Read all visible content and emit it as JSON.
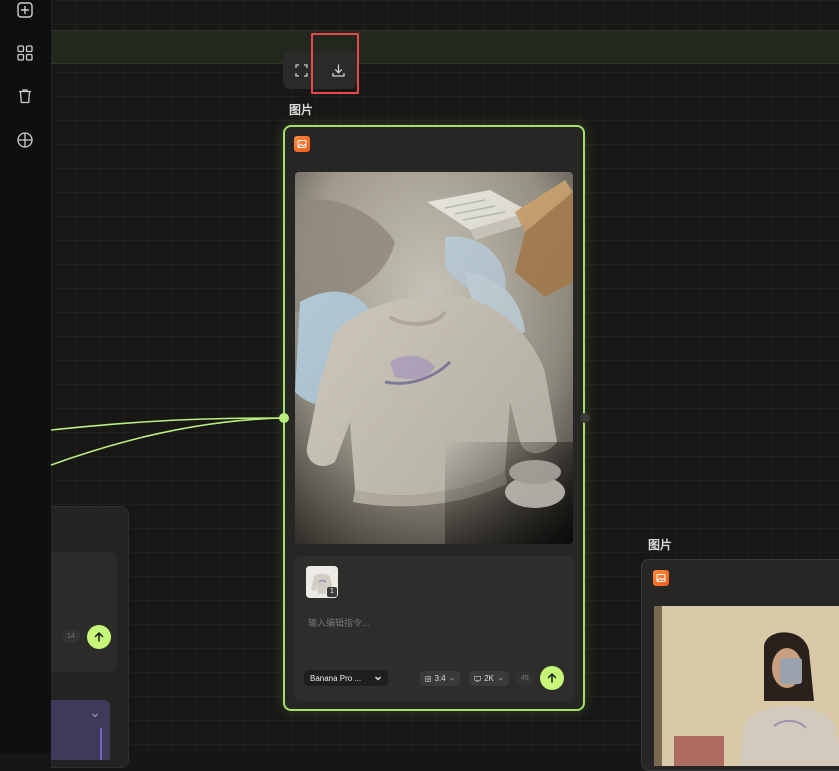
{
  "toolbar": {
    "items": [
      {
        "name": "add-node-button",
        "icon": "plus-square-icon"
      },
      {
        "name": "apps-button",
        "icon": "grid-icon"
      },
      {
        "name": "delete-button",
        "icon": "trash-icon"
      },
      {
        "name": "globe-button",
        "icon": "globe-icon"
      }
    ]
  },
  "action_bar": {
    "fullscreen_icon": "fullscreen-icon",
    "download_icon": "download-icon"
  },
  "main_node": {
    "title": "图片",
    "badge_icon": "image-icon",
    "reference_count": "1",
    "prompt_placeholder": "输入编辑指令...",
    "model_value": "Banana Pro ...",
    "aspect_ratio": "3:4",
    "resolution": "2K",
    "credits": "49"
  },
  "left_node": {
    "credits": "14"
  },
  "right_node": {
    "title": "图片",
    "badge_icon": "image-icon"
  },
  "colors": {
    "accent": "#a4e067",
    "send_button": "#c6f778",
    "highlight": "#e8474c",
    "badge": "#f06a24"
  }
}
